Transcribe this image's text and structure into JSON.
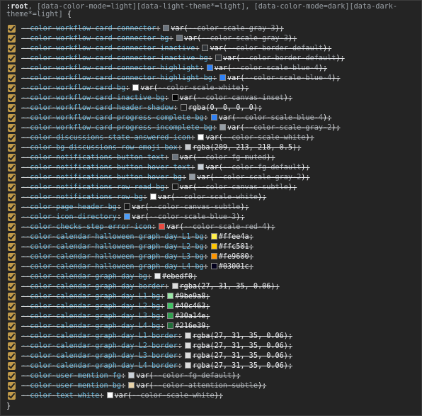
{
  "rule": {
    "selector_root": ":root",
    "selector_rest": ", [data-color-mode=light][data-light-theme*=light], [data-color-mode=dark][data-dark-theme*=light]",
    "open_brace": "{",
    "close_brace": "}"
  },
  "declarations": [
    {
      "name": "--color-workflow-card-connector",
      "func": "var(",
      "ref": "--color-scale-gray-3",
      "swatch": "#6a737d"
    },
    {
      "name": "--color-workflow-card-connector-bg",
      "func": "var(",
      "ref": "--color-scale-gray-3",
      "swatch": "#6a737d"
    },
    {
      "name": "--color-workflow-card-connector-inactive",
      "func": "var(",
      "ref": "--color-border-default",
      "swatch": "#2f3337"
    },
    {
      "name": "--color-workflow-card-connector-inactive-bg",
      "func": "var(",
      "ref": "--color-border-default",
      "swatch": "#2f3337"
    },
    {
      "name": "--color-workflow-card-connector-highlight",
      "func": "var(",
      "ref": "--color-scale-blue-4",
      "swatch": "#2f81f7"
    },
    {
      "name": "--color-workflow-card-connector-highlight-bg",
      "func": "var(",
      "ref": "--color-scale-blue-4",
      "swatch": "#2f81f7"
    },
    {
      "name": "--color-workflow-card-bg",
      "func": "var(",
      "ref": "--color-scale-white",
      "swatch": "#ffffff"
    },
    {
      "name": "--color-workflow-card-inactive-bg",
      "func": "var(",
      "ref": "--color-canvas-inset",
      "swatch": "#000000"
    },
    {
      "name": "--color-workflow-card-header-shadow",
      "func": "rgba(0, 0, 0, 0)",
      "ref": "",
      "swatch": "#1e1e1e"
    },
    {
      "name": "--color-workflow-card-progress-complete-bg",
      "func": "var(",
      "ref": "--color-scale-blue-4",
      "swatch": "#2f81f7"
    },
    {
      "name": "--color-workflow-card-progress-incomplete-bg",
      "func": "var(",
      "ref": "--color-scale-gray-2",
      "swatch": "#959da5"
    },
    {
      "name": "--color-discussions-state-answered-icon",
      "func": "var(",
      "ref": "--color-scale-white",
      "swatch": "#ffffff"
    },
    {
      "name": "--color-bg-discussions-row-emoji-box",
      "func": "rgba(209, 213, 218, 0.5)",
      "ref": "",
      "swatch": "#c8cbcf"
    },
    {
      "name": "--color-notifications-button-text",
      "func": "var(",
      "ref": "--color-fg-muted",
      "swatch": "#6a737d"
    },
    {
      "name": "--color-notifications-button-hover-text",
      "func": "var(",
      "ref": "--color-fg-default",
      "swatch": "#c9d1d9"
    },
    {
      "name": "--color-notifications-button-hover-bg",
      "func": "var(",
      "ref": "--color-scale-gray-2",
      "swatch": "#959da5"
    },
    {
      "name": "--color-notifications-row-read-bg",
      "func": "var(",
      "ref": "--color-canvas-subtle",
      "swatch": "#161616"
    },
    {
      "name": "--color-notifications-row-bg",
      "func": "var(",
      "ref": "--color-scale-white",
      "swatch": "#ffffff"
    },
    {
      "name": "--color-page-header-bg",
      "func": "var(",
      "ref": "--color-canvas-subtle",
      "swatch": "#161616"
    },
    {
      "name": "--color-icon-directory",
      "func": "var(",
      "ref": "--color-scale-blue-3",
      "swatch": "#4c9cf7"
    },
    {
      "name": "--color-checks-step-error-icon",
      "func": "var(",
      "ref": "--color-scale-red-4",
      "swatch": "#ea4a40"
    },
    {
      "name": "--color-calendar-halloween-graph-day-L1-bg",
      "func": "#ffee4a",
      "ref": "",
      "swatch": "#ffee4a"
    },
    {
      "name": "--color-calendar-halloween-graph-day-L2-bg",
      "func": "#ffc501",
      "ref": "",
      "swatch": "#ffc501"
    },
    {
      "name": "--color-calendar-halloween-graph-day-L3-bg",
      "func": "#fe9600",
      "ref": "",
      "swatch": "#fe9600"
    },
    {
      "name": "--color-calendar-halloween-graph-day-L4-bg",
      "func": "#03001c",
      "ref": "",
      "swatch": "#03001c"
    },
    {
      "name": "--color-calendar-graph-day-bg",
      "func": "#ebedf0",
      "ref": "",
      "swatch": "#ebedf0"
    },
    {
      "name": "--color-calendar-graph-day-border",
      "func": "rgba(27, 31, 35, 0.06)",
      "ref": "",
      "swatch": "#dcdcdc"
    },
    {
      "name": "--color-calendar-graph-day-L1-bg",
      "func": "#9be9a8",
      "ref": "",
      "swatch": "#9be9a8"
    },
    {
      "name": "--color-calendar-graph-day-L2-bg",
      "func": "#40c463",
      "ref": "",
      "swatch": "#40c463"
    },
    {
      "name": "--color-calendar-graph-day-L3-bg",
      "func": "#30a14e",
      "ref": "",
      "swatch": "#30a14e"
    },
    {
      "name": "--color-calendar-graph-day-L4-bg",
      "func": "#216e39",
      "ref": "",
      "swatch": "#216e39"
    },
    {
      "name": "--color-calendar-graph-day-L1-border",
      "func": "rgba(27, 31, 35, 0.06)",
      "ref": "",
      "swatch": "#dcdcdc"
    },
    {
      "name": "--color-calendar-graph-day-L2-border",
      "func": "rgba(27, 31, 35, 0.06)",
      "ref": "",
      "swatch": "#dcdcdc"
    },
    {
      "name": "--color-calendar-graph-day-L3-border",
      "func": "rgba(27, 31, 35, 0.06)",
      "ref": "",
      "swatch": "#dcdcdc"
    },
    {
      "name": "--color-calendar-graph-day-L4-border",
      "func": "rgba(27, 31, 35, 0.06)",
      "ref": "",
      "swatch": "#dcdcdc"
    },
    {
      "name": "--color-user-mention-fg",
      "func": "var(",
      "ref": "--color-fg-default",
      "swatch": "#c9d1d9"
    },
    {
      "name": "--color-user-mention-bg",
      "func": "var(",
      "ref": "--color-attention-subtle",
      "swatch": "#e8d3a8"
    },
    {
      "name": "--color-text-white",
      "func": "var(",
      "ref": "--color-scale-white",
      "swatch": "#ffffff"
    }
  ]
}
